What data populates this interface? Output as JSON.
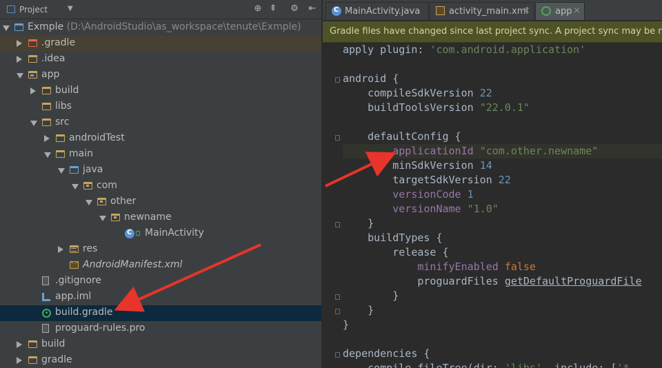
{
  "panel": {
    "title": "Project",
    "dropdown_icon": "chevron-down-icon",
    "tools": [
      {
        "icon": "locate-icon",
        "glyph": "⊕"
      },
      {
        "icon": "collapse-all-icon",
        "glyph": "⇞"
      },
      {
        "icon": "settings-icon",
        "glyph": "⚙"
      },
      {
        "icon": "hide-icon",
        "glyph": "⇤"
      }
    ]
  },
  "tree": [
    {
      "label": "Exmple",
      "path": "(D:\\AndroidStudio\\as_workspace\\tenute\\Exmple)",
      "icon": "project",
      "arrow": "down",
      "indent": 0
    },
    {
      "label": ".gradle",
      "icon": "folder-red",
      "arrow": "right",
      "indent": 1,
      "highlight": true
    },
    {
      "label": ".idea",
      "icon": "folder",
      "arrow": "right",
      "indent": 1
    },
    {
      "label": "app",
      "icon": "module",
      "arrow": "down",
      "indent": 1
    },
    {
      "label": "build",
      "icon": "folder",
      "arrow": "right",
      "indent": 2
    },
    {
      "label": "libs",
      "icon": "folder",
      "arrow": "none",
      "indent": 2
    },
    {
      "label": "src",
      "icon": "folder",
      "arrow": "down",
      "indent": 2
    },
    {
      "label": "androidTest",
      "icon": "folder",
      "arrow": "right",
      "indent": 3
    },
    {
      "label": "main",
      "icon": "folder",
      "arrow": "down",
      "indent": 3
    },
    {
      "label": "java",
      "icon": "folder-blue",
      "arrow": "down",
      "indent": 4
    },
    {
      "label": "com",
      "icon": "folder-pkg",
      "arrow": "down",
      "indent": 5
    },
    {
      "label": "other",
      "icon": "folder-pkg",
      "arrow": "down",
      "indent": 6
    },
    {
      "label": "newname",
      "icon": "folder-pkg",
      "arrow": "down",
      "indent": 7
    },
    {
      "label": "MainActivity",
      "icon": "cls",
      "arrow": "none",
      "indent": 8,
      "lock": true
    },
    {
      "label": "res",
      "icon": "res",
      "arrow": "right",
      "indent": 4
    },
    {
      "label": "AndroidManifest.xml",
      "icon": "xml",
      "arrow": "none",
      "indent": 4,
      "italic": true
    },
    {
      "label": ".gitignore",
      "icon": "textfile",
      "arrow": "none",
      "indent": 2
    },
    {
      "label": "app.iml",
      "icon": "iml",
      "arrow": "none",
      "indent": 2
    },
    {
      "label": "build.gradle",
      "icon": "gradle",
      "arrow": "none",
      "indent": 2,
      "selected": true
    },
    {
      "label": "proguard-rules.pro",
      "icon": "proguard",
      "arrow": "none",
      "indent": 2
    },
    {
      "label": "build",
      "icon": "folder",
      "arrow": "right",
      "indent": 1
    },
    {
      "label": "gradle",
      "icon": "folder",
      "arrow": "right",
      "indent": 1
    }
  ],
  "tabs": [
    {
      "label": "MainActivity.java",
      "icon": "class-icon",
      "close": "×"
    },
    {
      "label": "activity_main.xml",
      "icon": "xml-icon",
      "close": "×"
    },
    {
      "label": "app",
      "icon": "gradle-icon",
      "close": "×",
      "active": true
    }
  ],
  "banner": {
    "text": "Gradle files have changed since last project sync. A project sync may be nece"
  },
  "code": [
    [
      [
        "apply plugin: ",
        ""
      ],
      [
        "'com.android.application'",
        "str"
      ]
    ],
    [],
    [
      [
        "android {",
        ""
      ]
    ],
    [
      [
        "    compileSdkVersion ",
        ""
      ],
      [
        "22",
        "num"
      ]
    ],
    [
      [
        "    buildToolsVersion ",
        ""
      ],
      [
        "\"22.0.1\"",
        "str"
      ]
    ],
    [],
    [
      [
        "    defaultConfig {",
        ""
      ]
    ],
    [
      [
        "        ",
        ""
      ],
      [
        "applicationId",
        "purple"
      ],
      [
        " ",
        ""
      ],
      [
        "\"com.other.newname\"",
        "str"
      ]
    ],
    [
      [
        "        minSdkVersion ",
        ""
      ],
      [
        "14",
        "num"
      ]
    ],
    [
      [
        "        targetSdkVersion ",
        ""
      ],
      [
        "22",
        "num"
      ]
    ],
    [
      [
        "        ",
        ""
      ],
      [
        "versionCode",
        "purple"
      ],
      [
        " ",
        ""
      ],
      [
        "1",
        "num"
      ]
    ],
    [
      [
        "        ",
        ""
      ],
      [
        "versionName",
        "purple"
      ],
      [
        " ",
        ""
      ],
      [
        "\"1.0\"",
        "str"
      ]
    ],
    [
      [
        "    }",
        ""
      ]
    ],
    [
      [
        "    buildTypes {",
        ""
      ]
    ],
    [
      [
        "        release {",
        ""
      ]
    ],
    [
      [
        "            ",
        ""
      ],
      [
        "minifyEnabled",
        "purple"
      ],
      [
        " ",
        ""
      ],
      [
        "false",
        "kw"
      ]
    ],
    [
      [
        "            proguardFiles ",
        ""
      ],
      [
        "getDefaultProguardFile",
        "ul"
      ]
    ],
    [
      [
        "        }",
        ""
      ]
    ],
    [
      [
        "    }",
        ""
      ]
    ],
    [
      [
        "}",
        ""
      ]
    ],
    [],
    [
      [
        "dependencies {",
        ""
      ]
    ],
    [
      [
        "    compile fileTree(dir: ",
        ""
      ],
      [
        "'libs'",
        "str"
      ],
      [
        ", include: [",
        ""
      ],
      [
        "'*",
        "str"
      ]
    ]
  ],
  "colors": {
    "selection": "#0d293e",
    "highlight_row": "#464133",
    "banner_bg": "#4f5227",
    "arrow_annotation": "#e8342a"
  }
}
